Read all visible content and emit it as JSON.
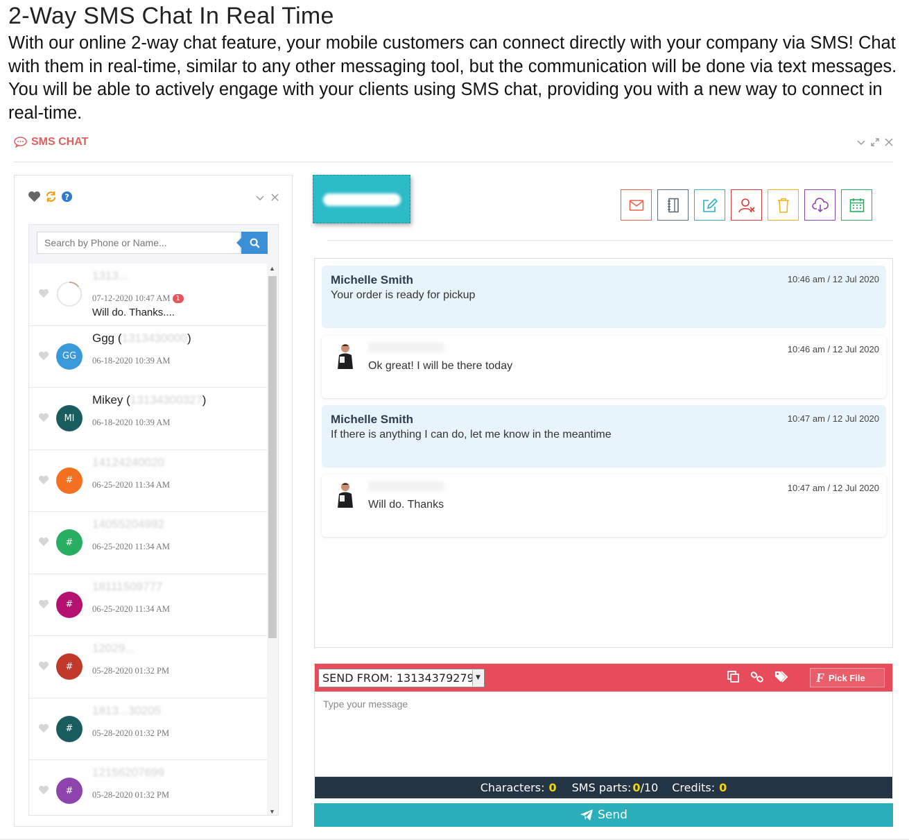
{
  "page": {
    "title": "2-Way SMS Chat In Real Time",
    "description": "With our online 2-way chat feature, your mobile customers can connect directly with your company via SMS! Chat with them in real-time, similar to any other messaging tool, but the communication will be done via text messages. You will be able to actively engage with your clients using SMS chat, providing you with a new way to connect in real-time."
  },
  "widget": {
    "title": "SMS CHAT",
    "icon": "chat-bubble-icon",
    "controls": [
      "chevron-down-icon",
      "expand-icon",
      "close-icon"
    ]
  },
  "sidebar": {
    "tools": [
      "heart-icon",
      "refresh-icon",
      "help-icon"
    ],
    "search": {
      "placeholder": "Search by Phone or Name...",
      "button_icon": "search-icon"
    },
    "contacts": [
      {
        "initials": "",
        "color": "#ffffff",
        "name": "",
        "name_blur": "1313...",
        "date": "07-12-2020 10:47 AM",
        "badge": "1",
        "preview": "Will do. Thanks...."
      },
      {
        "initials": "GG",
        "color": "#3a9ad9",
        "name": "Ggg (",
        "name_blur": "1313430000",
        "name_end": ")",
        "date": "06-18-2020 10:39 AM",
        "badge": "",
        "preview": ""
      },
      {
        "initials": "MI",
        "color": "#1a5d5e",
        "name": "Mikey (",
        "name_blur": "13134300327",
        "name_end": ")",
        "date": "06-18-2020 10:39 AM",
        "badge": "",
        "preview": ""
      },
      {
        "initials": "#",
        "color": "#f37021",
        "name": "",
        "name_blur": "14124240020",
        "date": "06-25-2020 11:34 AM",
        "badge": "",
        "preview": ""
      },
      {
        "initials": "#",
        "color": "#27ae60",
        "name": "",
        "name_blur": "14055204992",
        "date": "06-25-2020 11:34 AM",
        "badge": "",
        "preview": ""
      },
      {
        "initials": "#",
        "color": "#b5126f",
        "name": "",
        "name_blur": "18111509777",
        "date": "06-25-2020 11:34 AM",
        "badge": "",
        "preview": ""
      },
      {
        "initials": "#",
        "color": "#c0392b",
        "name": "",
        "name_blur": "12029...",
        "date": "05-28-2020 01:32 PM",
        "badge": "",
        "preview": ""
      },
      {
        "initials": "#",
        "color": "#1a5d5e",
        "name": "",
        "name_blur": "1813...30205",
        "date": "05-28-2020 01:32 PM",
        "badge": "",
        "preview": ""
      },
      {
        "initials": "#",
        "color": "#8e44ad",
        "name": "",
        "name_blur": "12156207699",
        "date": "05-28-2020 01:32 PM",
        "badge": "",
        "preview": ""
      }
    ]
  },
  "toolbar": {
    "buttons": [
      {
        "icon": "envelope-icon",
        "color": "#e8624a"
      },
      {
        "icon": "notebook-icon",
        "color": "#5a6b7b"
      },
      {
        "icon": "edit-icon",
        "color": "#2bb0c4"
      },
      {
        "icon": "remove-user-icon",
        "color": "#d63a3a"
      },
      {
        "icon": "trash-icon",
        "color": "#e8b71a"
      },
      {
        "icon": "cloud-download-icon",
        "color": "#8e44ad"
      },
      {
        "icon": "calendar-icon",
        "color": "#27ae60"
      }
    ]
  },
  "messages": [
    {
      "direction": "in",
      "sender": "Michelle Smith",
      "text": "Your order is ready for pickup",
      "time": "10:46 am / 12 Jul 2020"
    },
    {
      "direction": "out",
      "sender": "",
      "text": "Ok great! I will be there today",
      "time": "10:46 am / 12 Jul 2020"
    },
    {
      "direction": "in",
      "sender": "Michelle Smith",
      "text": "If there is anything I can do, let me know in the meantime",
      "time": "10:47 am / 12 Jul 2020"
    },
    {
      "direction": "out",
      "sender": "",
      "text": "Will do. Thanks",
      "time": "10:47 am / 12 Jul 2020"
    }
  ],
  "compose": {
    "send_from": "SEND FROM: 13134379279",
    "icons": [
      "copy-icon",
      "link-icon",
      "tags-icon"
    ],
    "pick_file": "Pick File",
    "placeholder": "Type your message"
  },
  "counter": {
    "characters_label": "Characters:",
    "characters": "0",
    "sms_parts_label": "SMS parts:",
    "sms_parts": "0",
    "sms_parts_max": "/10",
    "credits_label": "Credits:",
    "credits": "0"
  },
  "send": {
    "label": "Send"
  },
  "colors": {
    "accent": "#e0605f",
    "teal": "#2aaeb9",
    "compose_bar": "#e74c5c",
    "counter_bg": "#233445"
  }
}
